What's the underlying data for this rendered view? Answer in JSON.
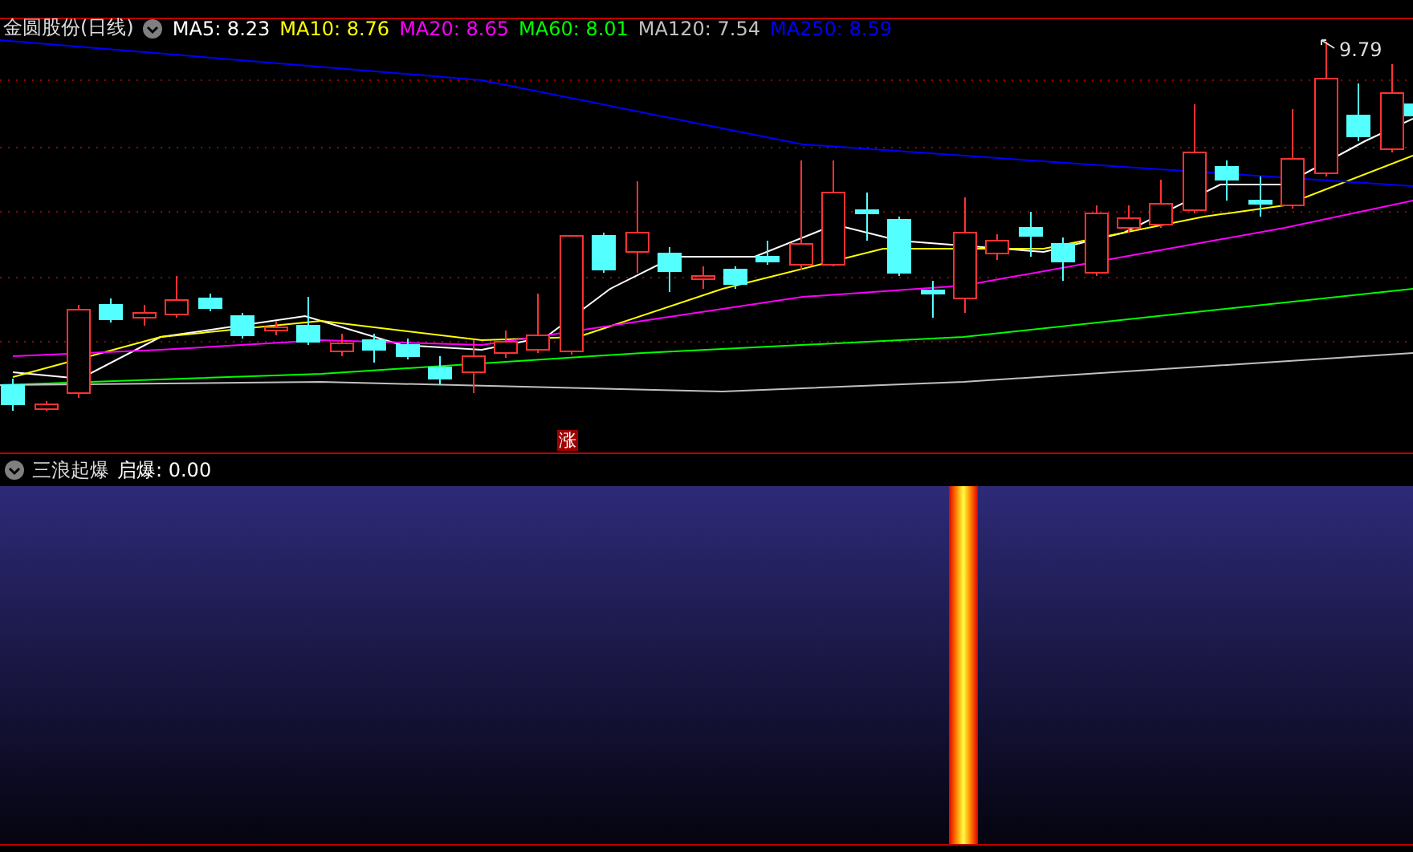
{
  "price_panel": {
    "title": "金圆股份(日线)",
    "moving_averages": [
      {
        "label": "MA5:",
        "value": "8.23",
        "color": "#ffffff"
      },
      {
        "label": "MA10:",
        "value": "8.76",
        "color": "#ffff00"
      },
      {
        "label": "MA20:",
        "value": "8.65",
        "color": "#ff00ff"
      },
      {
        "label": "MA60:",
        "value": "8.01",
        "color": "#00ff00"
      },
      {
        "label": "MA120:",
        "value": "7.54",
        "color": "#c0c0c0"
      },
      {
        "label": "MA250:",
        "value": "8.59",
        "color": "#0000ff"
      }
    ],
    "high_price": "9.79",
    "limit_up_marker": "涨"
  },
  "indicator_panel": {
    "name": "三浪起爆",
    "label": "启爆:",
    "value": "0.00"
  }
}
